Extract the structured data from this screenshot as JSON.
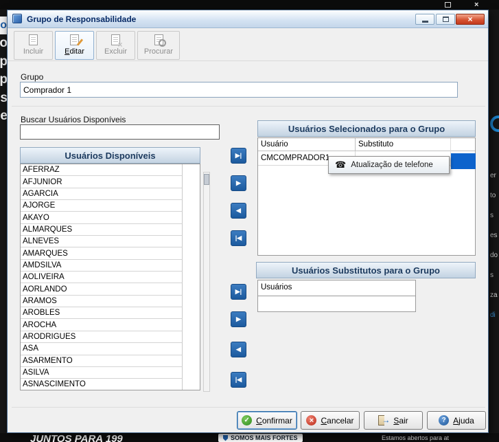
{
  "window": {
    "title": "Grupo de Responsabilidade"
  },
  "icons": {
    "close_glyph": "×",
    "check_glyph": "✓",
    "cancel_glyph": "×",
    "help_glyph": "?",
    "exit_arrow_glyph": "→",
    "phone_glyph": "☎"
  },
  "toolbar": {
    "items": [
      {
        "label": "Incluir",
        "enabled": false
      },
      {
        "label": "Editar",
        "enabled": true
      },
      {
        "label": "Excluir",
        "enabled": false
      },
      {
        "label": "Procurar",
        "enabled": false
      }
    ]
  },
  "grupo": {
    "label": "Grupo",
    "value": "Comprador 1"
  },
  "search": {
    "label": "Buscar Usuários Disponíveis",
    "value": ""
  },
  "available": {
    "header": "Usuários Disponíveis",
    "items": [
      "AFERRAZ",
      "AFJUNIOR",
      "AGARCIA",
      "AJORGE",
      "AKAYO",
      "ALMARQUES",
      "ALNEVES",
      "AMARQUES",
      "AMDSILVA",
      "AOLIVEIRA",
      "AORLANDO",
      "ARAMOS",
      "AROBLES",
      "AROCHA",
      "ARODRIGUES",
      "ASA",
      "ASARMENTO",
      "ASILVA",
      "ASNASCIMENTO"
    ]
  },
  "transfer": {
    "all_right": "▶|",
    "right": "▶",
    "left": "◀",
    "all_left": "|◀"
  },
  "selected": {
    "header": "Usuários Selecionados para o Grupo",
    "columns": {
      "usuario": "Usuário",
      "substituto": "Substituto"
    },
    "rows": [
      {
        "usuario": "CMCOMPRADOR1",
        "substituto": ""
      }
    ]
  },
  "tooltip": {
    "text": "Atualização de telefone"
  },
  "substitutes": {
    "header": "Usuários Substitutos para o Grupo",
    "column": "Usuários"
  },
  "footer": {
    "confirm": "Confirmar",
    "cancel": "Cancelar",
    "exit": "Sair",
    "help": "Ajuda"
  },
  "background": {
    "card_fragment": "o",
    "left_fragments": [
      "so",
      "mp",
      "mp",
      "res",
      "lie"
    ],
    "right_fragments": [
      "er",
      "to",
      "s",
      "es",
      "do",
      "s",
      "za",
      "di"
    ],
    "bottom": {
      "left_text": "JUNTOS PARA 199",
      "badge_text": "SOMOS MAIS FORTES",
      "right_text": "Estamos abertos para at"
    }
  }
}
